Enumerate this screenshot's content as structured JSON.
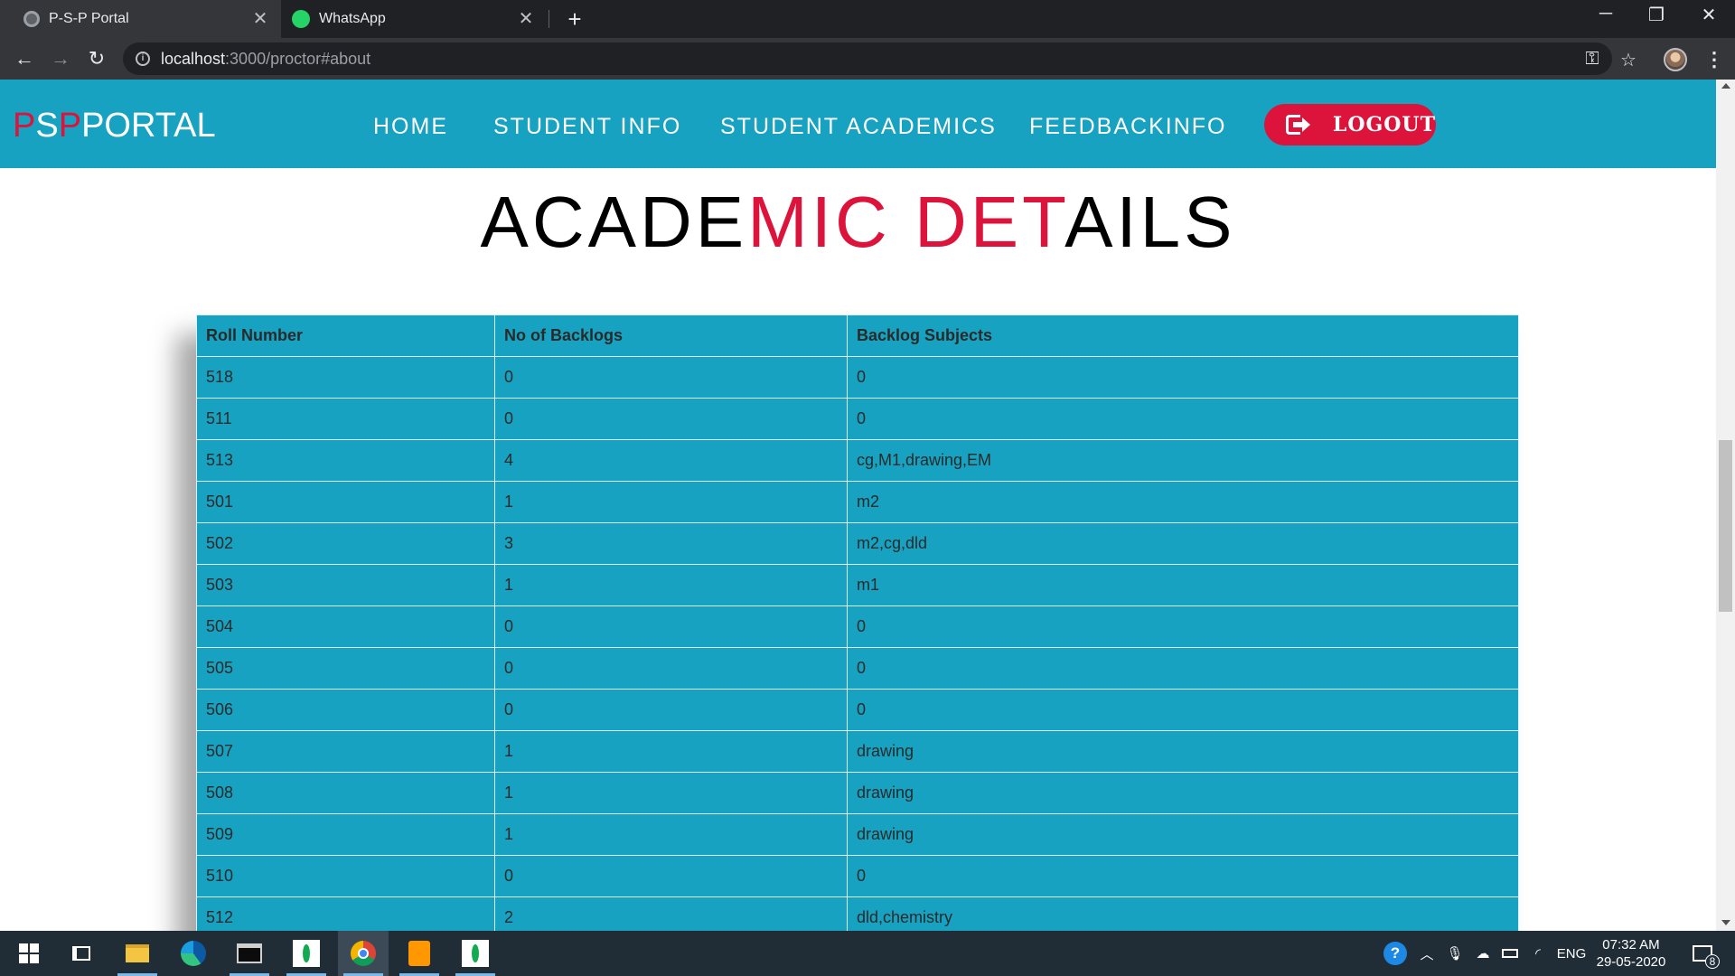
{
  "browser": {
    "tabs": [
      {
        "title": "P-S-P Portal",
        "active": true
      },
      {
        "title": "WhatsApp",
        "active": false
      }
    ],
    "address": {
      "host": "localhost",
      "rest": ":3000/proctor#about"
    }
  },
  "navbar": {
    "brand": {
      "p1": "P",
      "s": "S",
      "p2": "P",
      "portal": "PORTAL"
    },
    "links": [
      "HOME",
      "STUDENT INFO",
      "STUDENT ACADEMICS",
      "FEEDBACKINFO"
    ],
    "logout_label": "LOGOUT"
  },
  "title": {
    "black1": "ACADE",
    "red": "MIC DET",
    "black2": "AILS"
  },
  "table": {
    "headers": [
      "Roll Number",
      "No of Backlogs",
      "Backlog Subjects"
    ],
    "rows": [
      [
        "518",
        "0",
        "0"
      ],
      [
        "511",
        "0",
        "0"
      ],
      [
        "513",
        "4",
        "cg,M1,drawing,EM"
      ],
      [
        "501",
        "1",
        "m2"
      ],
      [
        "502",
        "3",
        "m2,cg,dld"
      ],
      [
        "503",
        "1",
        "m1"
      ],
      [
        "504",
        "0",
        "0"
      ],
      [
        "505",
        "0",
        "0"
      ],
      [
        "506",
        "0",
        "0"
      ],
      [
        "507",
        "1",
        "drawing"
      ],
      [
        "508",
        "1",
        "drawing"
      ],
      [
        "509",
        "1",
        "drawing"
      ],
      [
        "510",
        "0",
        "0"
      ],
      [
        "512",
        "2",
        "dld,chemistry"
      ]
    ]
  },
  "taskbar": {
    "lang": "ENG",
    "time": "07:32 AM",
    "date": "29-05-2020",
    "notifications": "8"
  },
  "colors": {
    "accent": "#17a2c1",
    "red": "#dc143c"
  }
}
